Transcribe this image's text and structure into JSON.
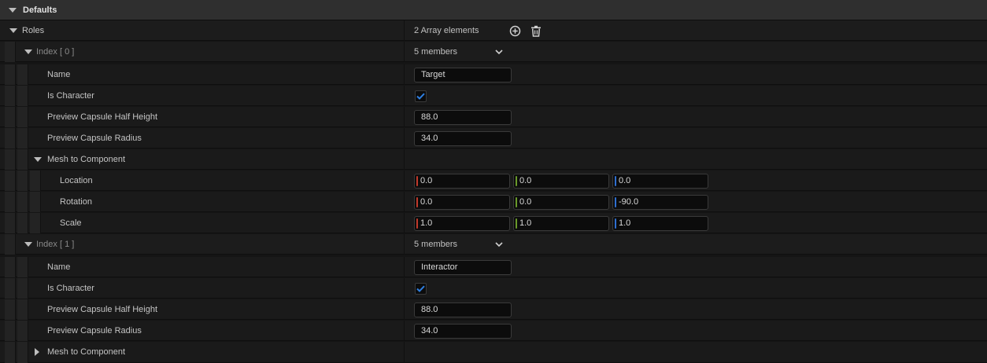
{
  "section": {
    "title": "Defaults"
  },
  "roles": {
    "label": "Roles",
    "count_text": "2 Array elements",
    "add_icon": "add-circle-icon",
    "delete_icon": "trash-icon"
  },
  "indices": [
    {
      "label": "Index [ 0 ]",
      "members_text": "5 members",
      "name_label": "Name",
      "name_value": "Target",
      "is_character_label": "Is Character",
      "is_character": true,
      "half_height_label": "Preview Capsule Half Height",
      "half_height_value": "88.0",
      "radius_label": "Preview Capsule Radius",
      "radius_value": "34.0",
      "mesh_label": "Mesh to Component",
      "mesh_expanded": true,
      "location_label": "Location",
      "location": [
        "0.0",
        "0.0",
        "0.0"
      ],
      "rotation_label": "Rotation",
      "rotation": [
        "0.0",
        "0.0",
        "-90.0"
      ],
      "scale_label": "Scale",
      "scale": [
        "1.0",
        "1.0",
        "1.0"
      ]
    },
    {
      "label": "Index [ 1 ]",
      "members_text": "5 members",
      "name_label": "Name",
      "name_value": "Interactor",
      "is_character_label": "Is Character",
      "is_character": true,
      "half_height_label": "Preview Capsule Half Height",
      "half_height_value": "88.0",
      "radius_label": "Preview Capsule Radius",
      "radius_value": "34.0",
      "mesh_label": "Mesh to Component",
      "mesh_expanded": false
    }
  ],
  "colors": {
    "axis_x": "#c1392b",
    "axis_y": "#6a9a2a",
    "axis_z": "#2f6fd0",
    "check": "#2f7fe0"
  }
}
